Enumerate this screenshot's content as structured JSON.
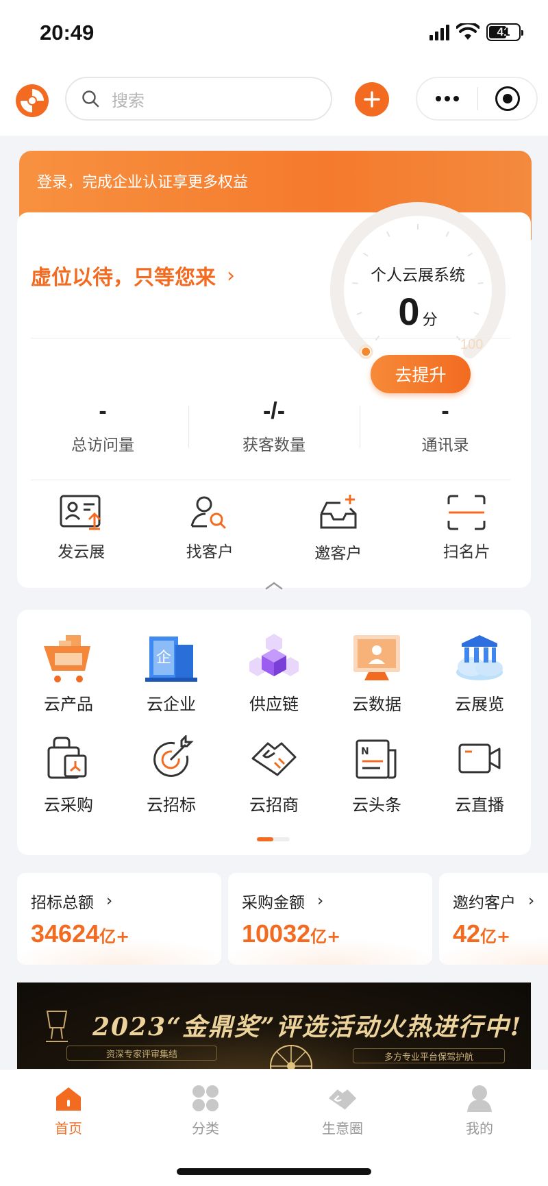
{
  "status_bar": {
    "time": "20:49",
    "battery": "41"
  },
  "nav": {
    "search_placeholder": "搜索"
  },
  "banner": {
    "text": "登录，完成企业认证享更多权益"
  },
  "profile": {
    "slogan": "虚位以待，只等您来",
    "gauge_title": "个人云展系统",
    "score": "0",
    "score_unit": "分",
    "score_max": "100",
    "score_fraction": 0,
    "upgrade_label": "去提升"
  },
  "stats": [
    {
      "value": "-",
      "label": "总访问量"
    },
    {
      "value": "-/-",
      "label": "获客数量"
    },
    {
      "value": "-",
      "label": "通讯录"
    }
  ],
  "actions": [
    {
      "icon": "id-card-upload-icon",
      "label": "发云展"
    },
    {
      "icon": "user-search-icon",
      "label": "找客户"
    },
    {
      "icon": "inbox-plus-icon",
      "label": "邀客户"
    },
    {
      "icon": "scan-card-icon",
      "label": "扫名片"
    }
  ],
  "services": [
    {
      "icon": "cart-icon",
      "label": "云产品"
    },
    {
      "icon": "enterprise-building-icon",
      "label": "云企业"
    },
    {
      "icon": "supply-chain-cubes-icon",
      "label": "供应链"
    },
    {
      "icon": "data-screen-icon",
      "label": "云数据"
    },
    {
      "icon": "exhibition-hall-icon",
      "label": "云展览"
    },
    {
      "icon": "purchase-bag-icon",
      "label": "云采购"
    },
    {
      "icon": "bid-target-icon",
      "label": "云招标"
    },
    {
      "icon": "handshake-icon",
      "label": "云招商"
    },
    {
      "icon": "newspaper-icon",
      "label": "云头条"
    },
    {
      "icon": "live-camera-icon",
      "label": "云直播"
    }
  ],
  "metrics": [
    {
      "label": "招标总额",
      "value": "34624",
      "unit": "亿+"
    },
    {
      "label": "采购金额",
      "value": "10032",
      "unit": "亿+"
    },
    {
      "label": "邀约客户",
      "value": "42",
      "unit": "亿+"
    }
  ],
  "promo": {
    "title": "2023“金鼎奖”评选活动火热进行中!",
    "tag_left": "资深专家评审集结",
    "tag_right": "多方专业平台保驾护航"
  },
  "tabbar": [
    {
      "icon": "home-icon",
      "label": "首页",
      "active": true
    },
    {
      "icon": "category-icon",
      "label": "分类",
      "active": false
    },
    {
      "icon": "business-circle-icon",
      "label": "生意圈",
      "active": false
    },
    {
      "icon": "profile-icon",
      "label": "我的",
      "active": false
    }
  ],
  "colors": {
    "accent": "#f26b21",
    "background": "#f3f4f7"
  }
}
